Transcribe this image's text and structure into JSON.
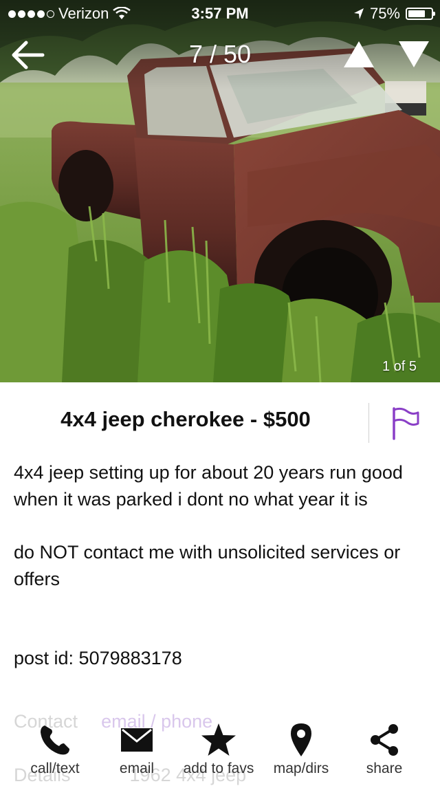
{
  "status_bar": {
    "carrier": "Verizon",
    "time": "3:57 PM",
    "battery_percent": "75%",
    "battery_level": 0.75,
    "signal_bars_filled": 4,
    "signal_bars_total": 5
  },
  "nav": {
    "counter": "7 / 50",
    "back_icon": "back-arrow-icon",
    "prev_icon": "up-triangle-icon",
    "next_icon": "down-triangle-icon"
  },
  "photo": {
    "counter": "1 of 5"
  },
  "listing": {
    "title": "4x4 jeep cherokee - $500",
    "flag_icon": "flag-icon",
    "flag_color": "#8a3fc7",
    "description_paragraphs": [
      "4x4 jeep   setting up  for about 20 years run good when it was parked i dont no what year it is",
      "do NOT contact me with unsolicited services or offers"
    ],
    "post_id": "post id: 5079883178"
  },
  "contact": {
    "label": "Contact",
    "link": "email / phone"
  },
  "details": {
    "label": "Details",
    "value": "1962 4x4 jeep"
  },
  "tab_bar": {
    "tabs": [
      {
        "label": "call/text",
        "icon": "phone-icon"
      },
      {
        "label": "email",
        "icon": "envelope-icon"
      },
      {
        "label": "add to favs",
        "icon": "star-icon"
      },
      {
        "label": "map/dirs",
        "icon": "map-pin-icon"
      },
      {
        "label": "share",
        "icon": "share-icon"
      }
    ]
  }
}
